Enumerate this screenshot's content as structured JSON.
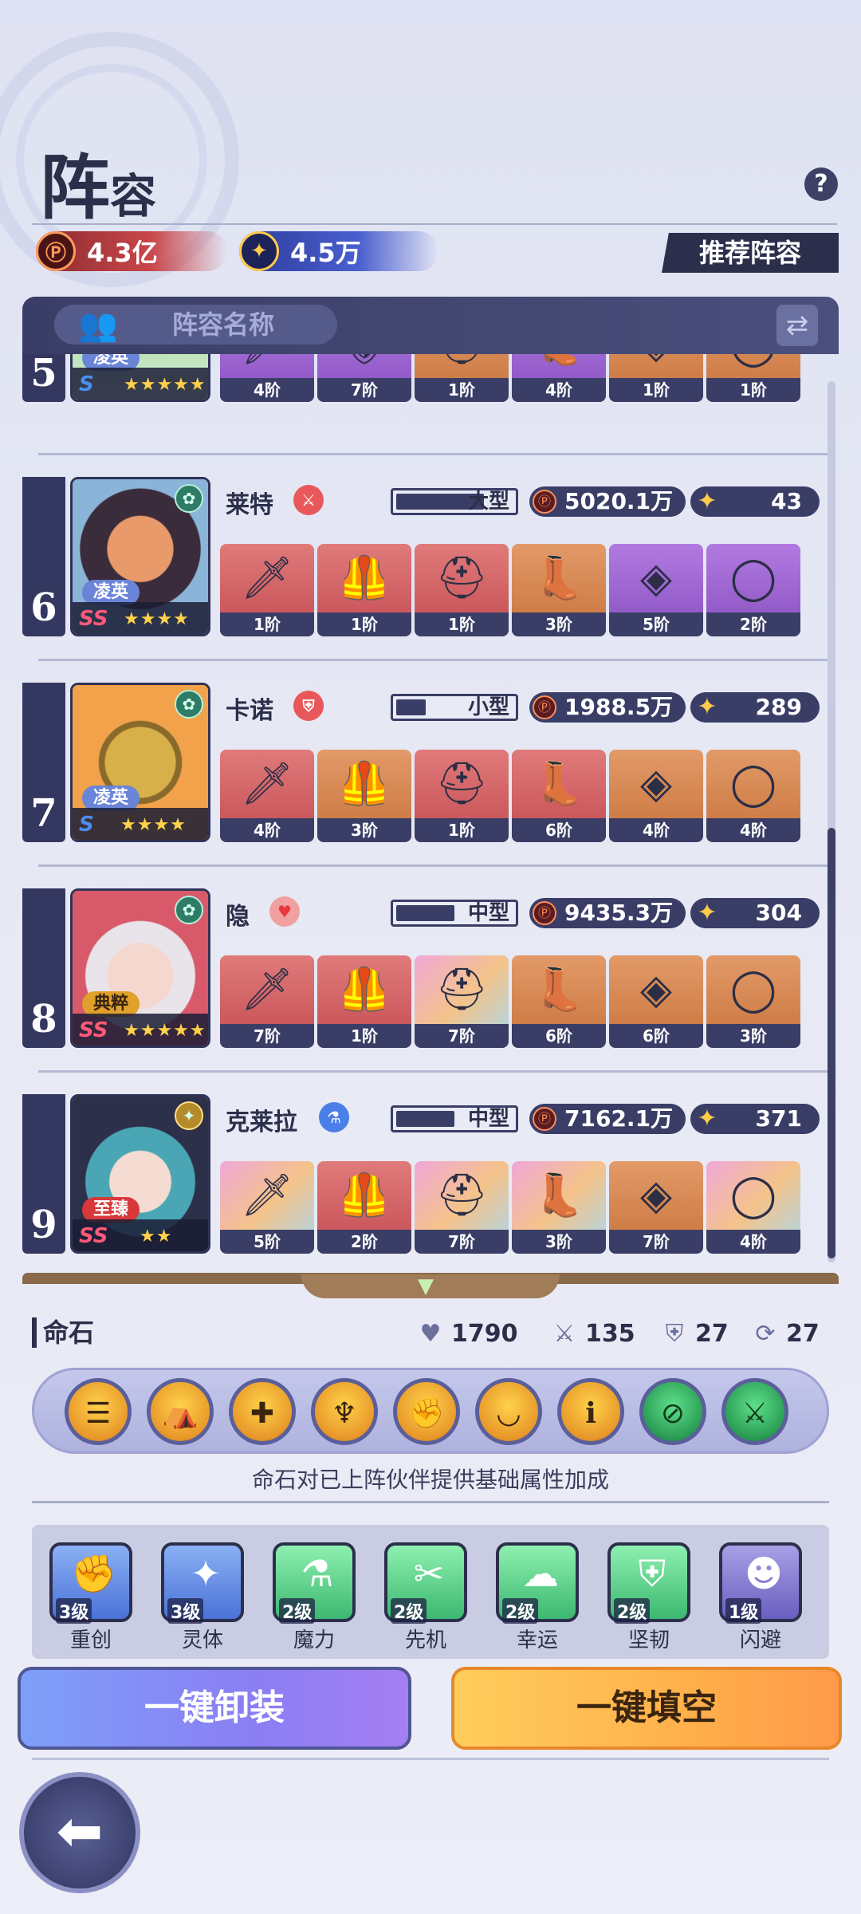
{
  "header": {
    "title_big": "阵",
    "title_small": "容",
    "help_icon": "?",
    "power_total": "4.3亿",
    "star_total": "4.5万",
    "recommend_label": "推荐阵容"
  },
  "team_bar": {
    "name_placeholder": "阵容名称",
    "swap_icon": "⇄"
  },
  "rows": [
    {
      "index": "5",
      "tier": "凌英",
      "stars": "★★★★★",
      "sclass": "S",
      "equips": [
        {
          "icon": "🗡",
          "level": "4阶",
          "quality": "purple"
        },
        {
          "icon": "🛡",
          "level": "7阶",
          "quality": "purple"
        },
        {
          "icon": "⛑",
          "level": "1阶",
          "quality": "orange"
        },
        {
          "icon": "👢",
          "level": "4阶",
          "quality": "purple"
        },
        {
          "icon": "◈",
          "level": "1阶",
          "quality": "orange"
        },
        {
          "icon": "◯",
          "level": "1阶",
          "quality": "orange"
        }
      ]
    },
    {
      "index": "6",
      "name": "莱特",
      "tier": "凌英",
      "stars": "★★★★",
      "sclass": "SS",
      "size": "大型",
      "size_fill": 0.75,
      "power": "5020.1万",
      "star": "43",
      "role_color": "#e8585a",
      "equips": [
        {
          "icon": "🗡",
          "level": "1阶",
          "quality": "red"
        },
        {
          "icon": "🦺",
          "level": "1阶",
          "quality": "red"
        },
        {
          "icon": "⛑",
          "level": "1阶",
          "quality": "red"
        },
        {
          "icon": "👢",
          "level": "3阶",
          "quality": "orange"
        },
        {
          "icon": "◈",
          "level": "5阶",
          "quality": "purple"
        },
        {
          "icon": "◯",
          "level": "2阶",
          "quality": "purple"
        }
      ]
    },
    {
      "index": "7",
      "name": "卡诺",
      "tier": "凌英",
      "stars": "★★★★",
      "sclass": "S",
      "size": "小型",
      "size_fill": 0.25,
      "power": "1988.5万",
      "star": "289",
      "role_color": "#e8585a",
      "equips": [
        {
          "icon": "🗡",
          "level": "4阶",
          "quality": "red"
        },
        {
          "icon": "🦺",
          "level": "3阶",
          "quality": "orange"
        },
        {
          "icon": "⛑",
          "level": "1阶",
          "quality": "red"
        },
        {
          "icon": "👢",
          "level": "6阶",
          "quality": "red"
        },
        {
          "icon": "◈",
          "level": "4阶",
          "quality": "orange"
        },
        {
          "icon": "◯",
          "level": "4阶",
          "quality": "orange"
        }
      ]
    },
    {
      "index": "8",
      "name": "隐",
      "tier": "典粹",
      "stars": "★★★★★",
      "sclass": "SS",
      "size": "中型",
      "size_fill": 0.5,
      "power": "9435.3万",
      "star": "304",
      "role_color": "#e8585a",
      "equips": [
        {
          "icon": "🗡",
          "level": "7阶",
          "quality": "red"
        },
        {
          "icon": "🦺",
          "level": "1阶",
          "quality": "red"
        },
        {
          "icon": "⛑",
          "level": "7阶",
          "quality": "rainbow"
        },
        {
          "icon": "👢",
          "level": "6阶",
          "quality": "orange"
        },
        {
          "icon": "◈",
          "level": "6阶",
          "quality": "orange"
        },
        {
          "icon": "◯",
          "level": "3阶",
          "quality": "orange"
        }
      ]
    },
    {
      "index": "9",
      "name": "克莱拉",
      "tier": "至臻",
      "stars": "★★",
      "sclass": "SS",
      "size": "中型",
      "size_fill": 0.5,
      "power": "7162.1万",
      "star": "371",
      "role_color": "#4a7ee8",
      "equips": [
        {
          "icon": "🗡",
          "level": "5阶",
          "quality": "rainbow"
        },
        {
          "icon": "🦺",
          "level": "2阶",
          "quality": "red"
        },
        {
          "icon": "⛑",
          "level": "7阶",
          "quality": "rainbow"
        },
        {
          "icon": "👢",
          "level": "3阶",
          "quality": "rainbow"
        },
        {
          "icon": "◈",
          "level": "7阶",
          "quality": "orange"
        },
        {
          "icon": "◯",
          "level": "4阶",
          "quality": "rainbow"
        }
      ]
    }
  ],
  "stones": {
    "title": "命石",
    "stats": [
      {
        "icon": "♥",
        "value": "1790"
      },
      {
        "icon": "⚔",
        "value": "135"
      },
      {
        "icon": "⛨",
        "value": "27"
      },
      {
        "icon": "⟳",
        "value": "27"
      }
    ],
    "items": [
      {
        "icon": "☰",
        "type": "gold"
      },
      {
        "icon": "⛺",
        "type": "gold"
      },
      {
        "icon": "✚",
        "type": "gold"
      },
      {
        "icon": "♆",
        "type": "gold"
      },
      {
        "icon": "✊",
        "type": "gold"
      },
      {
        "icon": "◡",
        "type": "gold"
      },
      {
        "icon": "ℹ",
        "type": "gold"
      },
      {
        "icon": "⊘",
        "type": "green"
      },
      {
        "icon": "⚔",
        "type": "green"
      }
    ],
    "description": "命石对已上阵伙伴提供基础属性加成"
  },
  "buffs": [
    {
      "name": "重创",
      "level": "3级",
      "icon": "✊",
      "color": "blue"
    },
    {
      "name": "灵体",
      "level": "3级",
      "icon": "✦",
      "color": "blue"
    },
    {
      "name": "魔力",
      "level": "2级",
      "icon": "⚗",
      "color": "green"
    },
    {
      "name": "先机",
      "level": "2级",
      "icon": "✂",
      "color": "green"
    },
    {
      "name": "幸运",
      "level": "2级",
      "icon": "☁",
      "color": "green"
    },
    {
      "name": "坚韧",
      "level": "2级",
      "icon": "⛨",
      "color": "green"
    },
    {
      "name": "闪避",
      "level": "1级",
      "icon": "☻",
      "color": "purple"
    }
  ],
  "actions": {
    "unload_label": "一键卸装",
    "fill_label": "一键填空",
    "back_icon": "⬅"
  }
}
